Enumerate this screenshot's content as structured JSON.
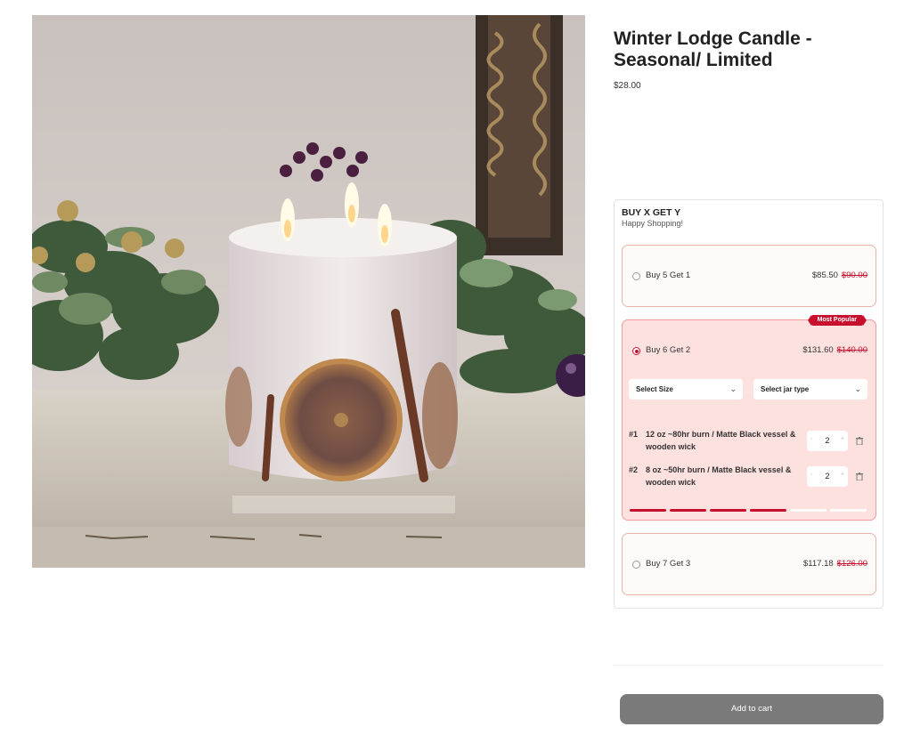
{
  "product": {
    "title": "Winter Lodge Candle - Seasonal/ Limited",
    "price": "$28.00"
  },
  "bundle": {
    "title": "BUY X GET Y",
    "subtitle": "Happy Shopping!",
    "options": [
      {
        "label": "Buy 5 Get 1",
        "price": "$85.50",
        "old_price": "$90.00",
        "selected": false
      },
      {
        "label": "Buy 6 Get 2",
        "price": "$131.60",
        "old_price": "$140.00",
        "selected": true,
        "badge": "Most Popular"
      },
      {
        "label": "Buy 7 Get 3",
        "price": "$117.18",
        "old_price": "$126.00",
        "selected": false
      }
    ],
    "size_select": "Select Size",
    "jar_select": "Select jar type",
    "items": [
      {
        "num": "#1",
        "text": "12 oz ~80hr burn / Matte Black vessel & wooden wick",
        "qty": "2"
      },
      {
        "num": "#2",
        "text": "8 oz ~50hr burn / Matte Black vessel & wooden wick",
        "qty": "2"
      }
    ],
    "progress": {
      "filled": 4,
      "total": 6
    },
    "stepper_minus": "-",
    "stepper_plus": "+"
  },
  "add_to_cart": "Add to cart",
  "colors": {
    "accent": "#c8102e",
    "selected_bg": "#fde1df",
    "button": "#7a7a7a"
  }
}
